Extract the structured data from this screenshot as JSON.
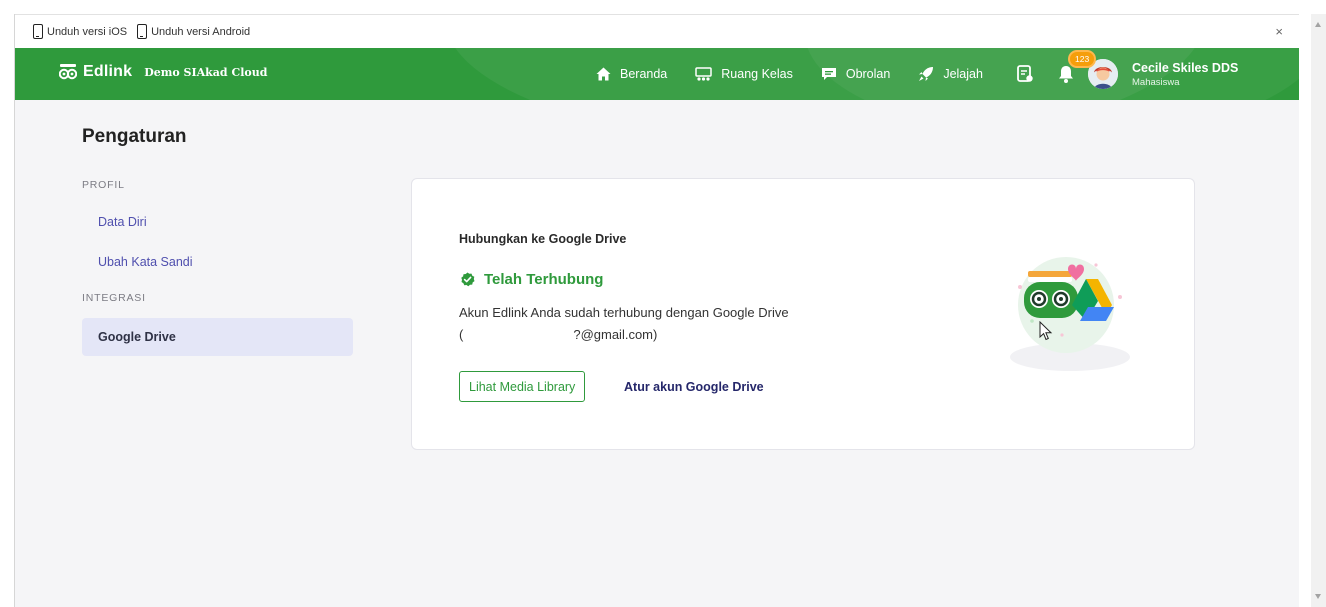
{
  "download_bar": {
    "ios_label": "Unduh versi iOS",
    "android_label": "Unduh versi Android",
    "close_label": "×"
  },
  "navbar": {
    "brand_name": "Edlink",
    "brand_sub": "Demo SIAkad Cloud",
    "items": [
      {
        "label": "Beranda",
        "icon": "home-icon"
      },
      {
        "label": "Ruang Kelas",
        "icon": "classroom-icon"
      },
      {
        "label": "Obrolan",
        "icon": "chat-icon"
      },
      {
        "label": "Jelajah",
        "icon": "rocket-icon"
      }
    ],
    "notification_count": "123",
    "user_name": "Cecile Skiles DDS",
    "user_role": "Mahasiswa",
    "color": "#2f9a3c"
  },
  "sidebar": {
    "page_title": "Pengaturan",
    "sections": [
      {
        "label": "PROFIL",
        "items": [
          {
            "label": "Data Diri"
          },
          {
            "label": "Ubah Kata Sandi"
          }
        ]
      },
      {
        "label": "INTEGRASI",
        "items": [
          {
            "label": "Google Drive",
            "active": true
          }
        ]
      }
    ]
  },
  "card": {
    "title": "Hubungkan ke Google Drive",
    "status": "Telah Terhubung",
    "description": "Akun Edlink Anda sudah terhubung dengan Google Drive",
    "email_open": "(",
    "email_visible": "?@gmail.com)",
    "primary_button": "Lihat Media Library",
    "secondary_link": "Atur akun Google Drive",
    "status_color": "#2f9a3c"
  }
}
